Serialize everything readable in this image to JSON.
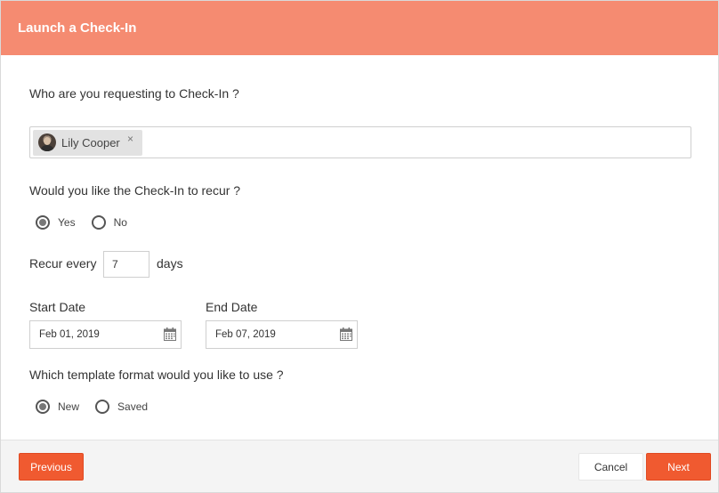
{
  "header": {
    "title": "Launch a Check-In"
  },
  "requestee": {
    "question": "Who are you requesting to Check-In ?",
    "tags": [
      {
        "name": "Lily Cooper",
        "remove_symbol": "×"
      }
    ]
  },
  "recur": {
    "question": "Would you like the Check-In to recur ?",
    "options": [
      {
        "label": "Yes",
        "selected": true
      },
      {
        "label": "No",
        "selected": false
      }
    ]
  },
  "recur_every": {
    "label": "Recur every",
    "value": "7",
    "unit": "days"
  },
  "dates": {
    "start": {
      "label": "Start Date",
      "value": "Feb 01, 2019"
    },
    "end": {
      "label": "End Date",
      "value": "Feb 07, 2019"
    }
  },
  "template": {
    "question": "Which template format would you like to use ?",
    "options": [
      {
        "label": "New",
        "selected": true
      },
      {
        "label": "Saved",
        "selected": false
      }
    ]
  },
  "footer": {
    "previous_label": "Previous",
    "cancel_label": "Cancel",
    "next_label": "Next"
  },
  "colors": {
    "header_bg": "#f58b71",
    "primary_button": "#f05a30"
  }
}
